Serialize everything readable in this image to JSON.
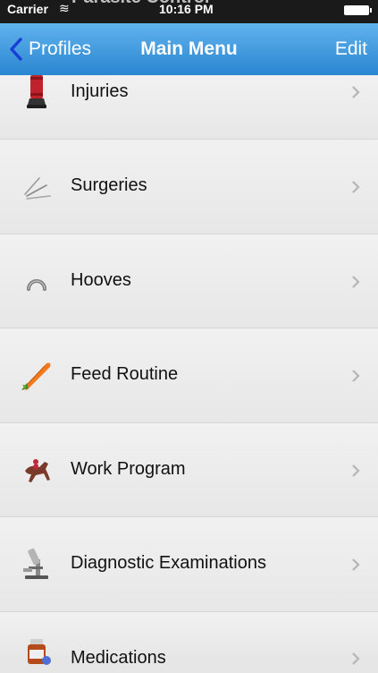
{
  "status_bar": {
    "carrier": "Carrier",
    "time": "10:16 PM",
    "behind_title": "Parasite Control"
  },
  "nav": {
    "back_label": "Profiles",
    "title": "Main Menu",
    "edit_label": "Edit"
  },
  "menu": {
    "items": [
      {
        "label": "Injuries",
        "icon": "leg-wrap-icon"
      },
      {
        "label": "Surgeries",
        "icon": "surgical-tools-icon"
      },
      {
        "label": "Hooves",
        "icon": "horseshoe-icon"
      },
      {
        "label": "Feed Routine",
        "icon": "carrot-icon"
      },
      {
        "label": "Work Program",
        "icon": "racehorse-icon"
      },
      {
        "label": "Diagnostic Examinations",
        "icon": "microscope-icon"
      },
      {
        "label": "Medications",
        "icon": "medicine-bottle-icon"
      }
    ]
  },
  "colors": {
    "nav_top": "#5fb2ec",
    "nav_bottom": "#2b86d1",
    "row_background": "#ececec",
    "back_chevron": "#1a3fd6"
  }
}
